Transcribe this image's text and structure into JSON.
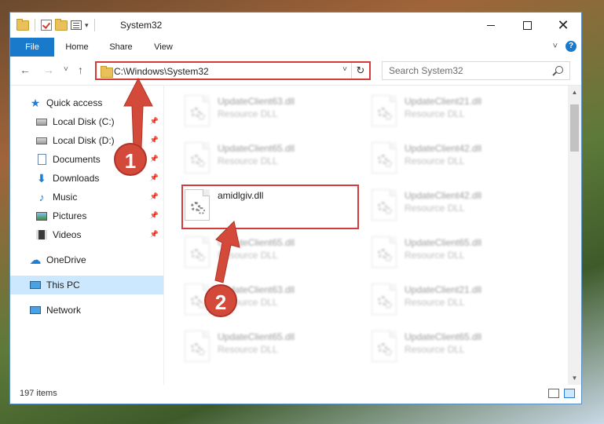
{
  "window": {
    "title": "System32",
    "qat_dropdown": "▾"
  },
  "ribbon": {
    "tabs": [
      {
        "label": "File"
      },
      {
        "label": "Home"
      },
      {
        "label": "Share"
      },
      {
        "label": "View"
      }
    ]
  },
  "nav": {
    "back": "←",
    "forward": "→",
    "recent": "˅",
    "up": "↑",
    "address": "C:\\Windows\\System32",
    "refresh": "↻",
    "search_placeholder": "Search System32"
  },
  "sidebar": {
    "items": [
      {
        "label": "Quick access",
        "icon": "star-icon"
      },
      {
        "label": "Local Disk (C:)",
        "icon": "disk-icon",
        "pinned": true
      },
      {
        "label": "Local Disk (D:)",
        "icon": "disk-icon",
        "pinned": true
      },
      {
        "label": "Documents",
        "icon": "documents-icon",
        "pinned": true
      },
      {
        "label": "Downloads",
        "icon": "download-icon",
        "pinned": true
      },
      {
        "label": "Music",
        "icon": "music-icon",
        "pinned": true
      },
      {
        "label": "Pictures",
        "icon": "pictures-icon",
        "pinned": true
      },
      {
        "label": "Videos",
        "icon": "videos-icon",
        "pinned": true
      },
      {
        "label": "OneDrive",
        "icon": "cloud-icon"
      },
      {
        "label": "This PC",
        "icon": "computer-icon",
        "selected": true
      },
      {
        "label": "Network",
        "icon": "network-icon"
      }
    ]
  },
  "files": {
    "left_column": [
      {
        "name": "UpdateClient63.dll",
        "type": "Resource DLL"
      },
      {
        "name": "UpdateClient65.dll",
        "type": "Resource DLL"
      },
      {
        "name": "amidlgiv.dll",
        "type": ""
      },
      {
        "name": "UpdateClient65.dll",
        "type": "Resource DLL"
      },
      {
        "name": "UpdateClient63.dll",
        "type": "Resource DLL"
      },
      {
        "name": "UpdateClient65.dll",
        "type": "Resource DLL"
      }
    ],
    "right_column": [
      {
        "name": "UpdateClient21.dll",
        "type": "Resource DLL"
      },
      {
        "name": "UpdateClient42.dll",
        "type": "Resource DLL"
      },
      {
        "name": "UpdateClient42.dll",
        "type": "Resource DLL"
      },
      {
        "name": "UpdateClient65.dll",
        "type": "Resource DLL"
      },
      {
        "name": "UpdateClient21.dll",
        "type": "Resource DLL"
      },
      {
        "name": "UpdateClient65.dll",
        "type": "Resource DLL"
      }
    ]
  },
  "status": {
    "items_count": "197 items"
  },
  "annotations": {
    "step1": "1",
    "step2": "2",
    "color": "#d63b3b"
  }
}
